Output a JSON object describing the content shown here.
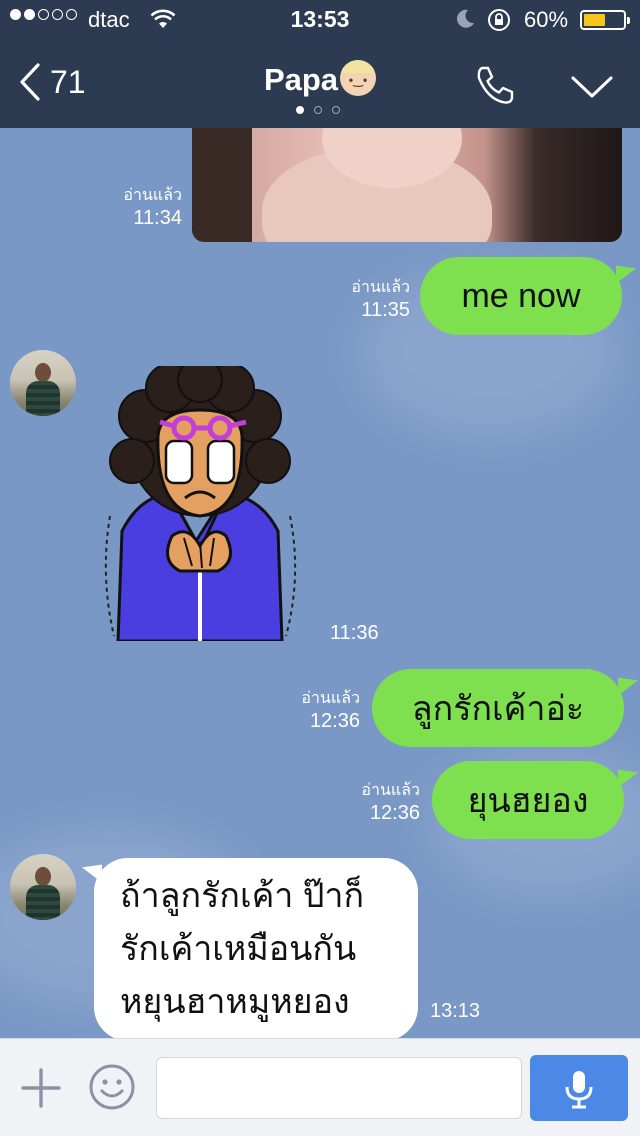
{
  "status_bar": {
    "carrier": "dtac",
    "time": "13:53",
    "battery_percent": "60%",
    "battery_level": 0.6,
    "signal_bars_filled": 2,
    "signal_bars_total": 5
  },
  "header": {
    "back_count": "71",
    "title": "Papa",
    "page_dots": 3,
    "active_dot": 0
  },
  "messages": [
    {
      "type": "image",
      "direction": "out",
      "read_label": "อ่านแล้ว",
      "time": "11:34"
    },
    {
      "type": "text",
      "direction": "out",
      "text": "me now",
      "read_label": "อ่านแล้ว",
      "time": "11:35"
    },
    {
      "type": "sticker",
      "direction": "in",
      "time": "11:36"
    },
    {
      "type": "text",
      "direction": "out",
      "text": "ลูกรักเค้าอ่ะ",
      "read_label": "อ่านแล้ว",
      "time": "12:36"
    },
    {
      "type": "text",
      "direction": "out",
      "text": "ยุนฮยอง",
      "read_label": "อ่านแล้ว",
      "time": "12:36"
    },
    {
      "type": "text",
      "direction": "in",
      "lines": [
        "ถ้าลูกรักเค้า ป๊าก็",
        "รักเค้าเหมือนกัน",
        "หยุนฮาหมูหยอง"
      ],
      "time": "13:13"
    }
  ],
  "composer": {
    "placeholder": ""
  },
  "colors": {
    "header_bg": "#2c3a52",
    "chat_bg": "#7a98c6",
    "outgoing_bubble": "#7fe04f",
    "incoming_bubble": "#ffffff",
    "mic_button": "#4c88e5",
    "battery": "#f5c51a"
  },
  "icons": {
    "back": "chevron-left-icon",
    "call": "phone-icon",
    "menu": "chevron-down-icon",
    "attach": "plus-icon",
    "emoji": "smiley-icon",
    "mic": "microphone-icon",
    "wifi": "wifi-icon",
    "moon": "moon-icon",
    "rotation_lock": "rotation-lock-icon"
  }
}
